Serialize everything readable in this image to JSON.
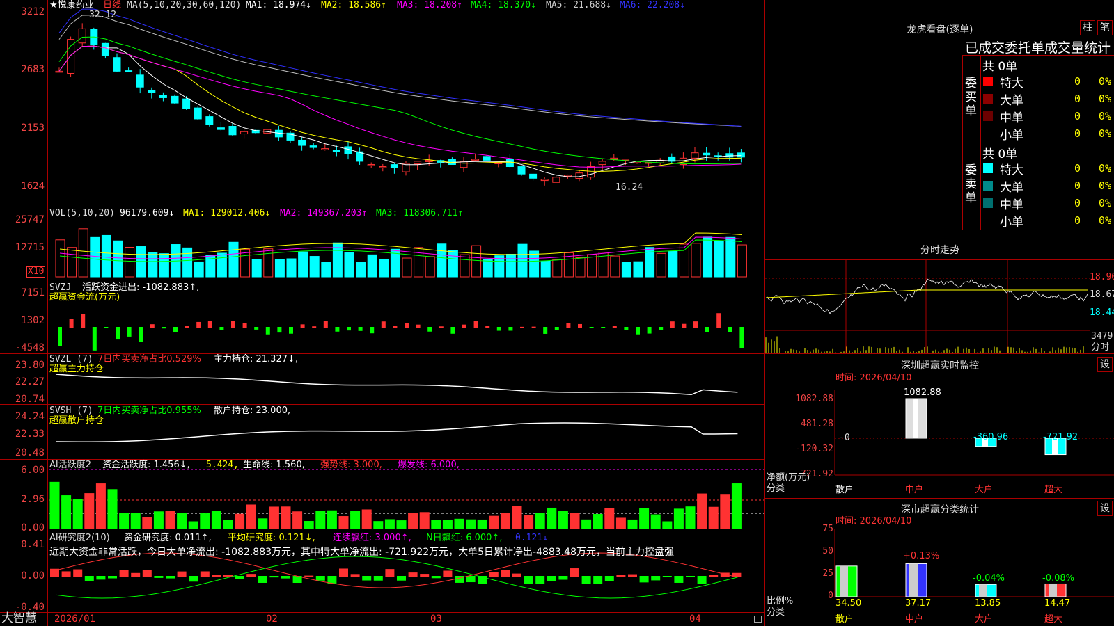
{
  "stock": {
    "name": "★悦康药业",
    "period": "日线"
  },
  "main_header": {
    "ma_params": "MA(5,10,20,30,60,120)",
    "ma1": "MA1: 18.974↓",
    "ma2": "MA2: 18.586↑",
    "ma3": "MA3: 18.208↑",
    "ma4": "MA4: 18.370↓",
    "ma5": "MA5: 21.688↓",
    "ma6": "MA6: 22.208↓"
  },
  "main_axis": [
    "3212",
    "2683",
    "2153",
    "1624"
  ],
  "max_price_label": "32.12",
  "min_price_label": "16.24",
  "vol_header": {
    "title": "VOL(5,10,20)",
    "v": "96179.609↓",
    "ma1": "MA1: 129012.406↓",
    "ma2": "MA2: 149367.203↑",
    "ma3": "MA3: 118306.711↑"
  },
  "vol_axis": [
    "25747",
    "12715"
  ],
  "vol_unit": "X10",
  "svzj": {
    "title": "SVZJ",
    "value": "活跃资金进出: -1082.883↑,",
    "subtitle": "超赢资金流(万元)",
    "axis": [
      "7151",
      "1302",
      "-4548"
    ]
  },
  "svzl": {
    "title": "SVZL (7)",
    "net": "7日内买卖净占比0.529%",
    "hold": "主力持仓: 21.327↓,",
    "subtitle": "超赢主力持仓",
    "axis": [
      "23.80",
      "22.27",
      "20.74"
    ]
  },
  "svsh": {
    "title": "SVSH (7)",
    "net": "7日内买卖净占比0.955%",
    "hold": "散户持仓: 23.000,",
    "subtitle": "超赢散户持仓",
    "axis": [
      "24.24",
      "22.33",
      "20.48"
    ]
  },
  "ai_active": {
    "title": "AI活跃度2",
    "value": "资金活跃度: 1.456↓,",
    "v2": "5.424,",
    "life": "生命线: 1.560,",
    "strong": "强势线: 3.000,",
    "burst": "爆发线: 6.000,",
    "axis": [
      "6.00",
      "2.96",
      "0.00"
    ]
  },
  "ai_research": {
    "title": "AI研究度2(10)",
    "value": "资金研究度: 0.011↑,",
    "avg": "平均研究度: 0.121↓,",
    "red": "连续飘红: 3.000↑,",
    "nred": "N日飘红: 6.000↑,",
    "v5": "0.121↓",
    "note": "近期大资金非常活跃，今日大单净流出: -1082.883万元，其中特大单净流出: -721.922万元，大单5日累计净出-4883.48万元，当前主力控盘强",
    "axis": [
      "0.41",
      "0.00",
      "-0.40"
    ]
  },
  "x_axis": [
    "2026/01",
    "02",
    "03",
    "04"
  ],
  "brand": "大智慧",
  "lhb": {
    "title": "龙虎看盘(逐单)",
    "btn1": "柱",
    "btn2": "笔",
    "subtitle": "已成交委托单成交量统计",
    "buy_label": "委买单",
    "sell_label": "委卖单",
    "buy_total": "共 0单",
    "sell_total": "共 0单",
    "buy_rows": [
      {
        "name": "特大",
        "count": "0",
        "pct": "0%",
        "color": "#ff0000"
      },
      {
        "name": "大单",
        "count": "0",
        "pct": "0%",
        "color": "#8b0000"
      },
      {
        "name": "中单",
        "count": "0",
        "pct": "0%",
        "color": "#6b0000"
      },
      {
        "name": "小单",
        "count": "0",
        "pct": "0%",
        "color": "#000000"
      }
    ],
    "sell_rows": [
      {
        "name": "特大",
        "count": "0",
        "pct": "0%",
        "color": "#00ffff"
      },
      {
        "name": "大单",
        "count": "0",
        "pct": "0%",
        "color": "#008b8b"
      },
      {
        "name": "中单",
        "count": "0",
        "pct": "0%",
        "color": "#007070"
      },
      {
        "name": "小单",
        "count": "0",
        "pct": "0%",
        "color": "#000000"
      }
    ]
  },
  "intraday": {
    "title": "分时走势",
    "p1": "18.90",
    "p2": "18.67",
    "p3": "18.44",
    "vol": "3479",
    "vol_unit": "分时"
  },
  "monitor": {
    "title": "深圳超赢实时监控",
    "btn": "设",
    "time": "时间: 2026/04/10",
    "axis": [
      "1082.88",
      "481.28",
      "-120.32",
      "-721.92"
    ],
    "unit": "净额(万元)",
    "cat_label": "分类",
    "zero_label": "-0",
    "bars": [
      {
        "name": "散户",
        "value": 0,
        "label": ""
      },
      {
        "name": "中户",
        "value": 1082.88,
        "label": "1082.88"
      },
      {
        "name": "大户",
        "value": -360.96,
        "label": "-360.96"
      },
      {
        "name": "超大",
        "value": -721.92,
        "label": "-721.92"
      }
    ]
  },
  "stats": {
    "title": "深市超赢分类统计",
    "btn": "设",
    "time": "时间: 2026/04/10",
    "axis": [
      "75",
      "50",
      "25",
      "0"
    ],
    "unit": "比例%",
    "cat_label": "分类",
    "bars": [
      {
        "name": "散户",
        "value": 34.5,
        "label": "34.50",
        "delta": ""
      },
      {
        "name": "中户",
        "value": 37.17,
        "label": "37.17",
        "delta": "+0.13%"
      },
      {
        "name": "大户",
        "value": 13.85,
        "label": "13.85",
        "delta": "-0.04%"
      },
      {
        "name": "超大",
        "value": 14.47,
        "label": "14.47",
        "delta": "-0.08%"
      }
    ]
  },
  "colors": {
    "up": "#ff3232",
    "down": "#00ffff",
    "grid": "#aa0000",
    "ma1": "#ffffff",
    "ma2": "#ffff00",
    "ma3": "#ff00ff",
    "ma4": "#00ff00",
    "ma5": "#c0c0c0",
    "ma6": "#3030ff"
  }
}
